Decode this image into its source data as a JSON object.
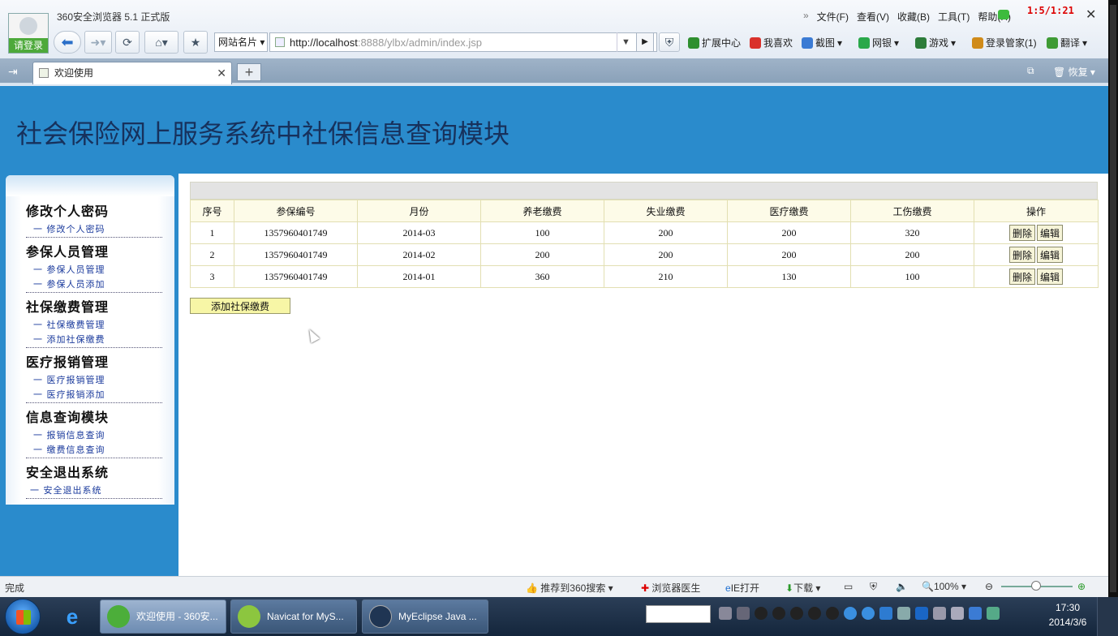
{
  "browser": {
    "title": "360安全浏览器 5.1 正式版",
    "login_label": "请登录",
    "menu": [
      "文件(F)",
      "查看(V)",
      "收藏(B)",
      "工具(T)",
      "帮助(H)"
    ],
    "red_counter": "1:5/1:21",
    "site_card": "网站名片",
    "url_host": "http://localhost",
    "url_rest": ":8888/ylbx/admin/index.jsp",
    "extensions": [
      {
        "label": "扩展中心",
        "icon": "extension-icon",
        "color": "#2f8f2f"
      },
      {
        "label": "我喜欢",
        "icon": "heart-icon",
        "color": "#d9312b"
      },
      {
        "label": "截图",
        "icon": "screenshot-icon",
        "color": "#3b7bd4"
      },
      {
        "label": "网银",
        "icon": "bank-icon",
        "color": "#2aa84a"
      },
      {
        "label": "游戏",
        "icon": "game-icon",
        "color": "#2d7c3a"
      },
      {
        "label": "登录管家(1)",
        "icon": "key-icon",
        "color": "#d08b1a"
      },
      {
        "label": "翻译",
        "icon": "translate-icon",
        "color": "#3f9b35"
      }
    ],
    "tab_title": "欢迎使用",
    "restore_label": "恢复"
  },
  "page": {
    "heading": "社会保险网上服务系统中社保信息查询模块",
    "sidebar": [
      {
        "title": "修改个人密码",
        "items": [
          "一 修改个人密码"
        ]
      },
      {
        "title": "参保人员管理",
        "items": [
          "一 参保人员管理",
          "一 参保人员添加"
        ]
      },
      {
        "title": "社保缴费管理",
        "items": [
          "一 社保缴费管理",
          "一 添加社保缴费"
        ]
      },
      {
        "title": "医疗报销管理",
        "items": [
          "一 医疗报销管理",
          "一 医疗报销添加"
        ]
      },
      {
        "title": "信息查询模块",
        "items": [
          "一 报销信息查询",
          "一 缴费信息查询"
        ]
      },
      {
        "title": "安全退出系统",
        "items": [
          "一 安全退出系统"
        ]
      }
    ],
    "table": {
      "columns": [
        "序号",
        "参保编号",
        "月份",
        "养老缴费",
        "失业缴费",
        "医疗缴费",
        "工伤缴费",
        "操作"
      ],
      "rows": [
        [
          "1",
          "1357960401749",
          "2014-03",
          "100",
          "200",
          "200",
          "320"
        ],
        [
          "2",
          "1357960401749",
          "2014-02",
          "200",
          "200",
          "200",
          "200"
        ],
        [
          "3",
          "1357960401749",
          "2014-01",
          "360",
          "210",
          "130",
          "100"
        ]
      ],
      "delete_label": "删除",
      "edit_label": "编辑"
    },
    "add_button": "添加社保缴费"
  },
  "status": {
    "text": "完成",
    "items": [
      "推荐到360搜索",
      "浏览器医生",
      "IE打开",
      "下载"
    ],
    "zoom": "100%"
  },
  "taskbar": {
    "tasks": [
      "欢迎使用 - 360安...",
      "Navicat for MyS...",
      "MyEclipse Java ..."
    ],
    "time": "17:30",
    "date": "2014/3/6"
  }
}
